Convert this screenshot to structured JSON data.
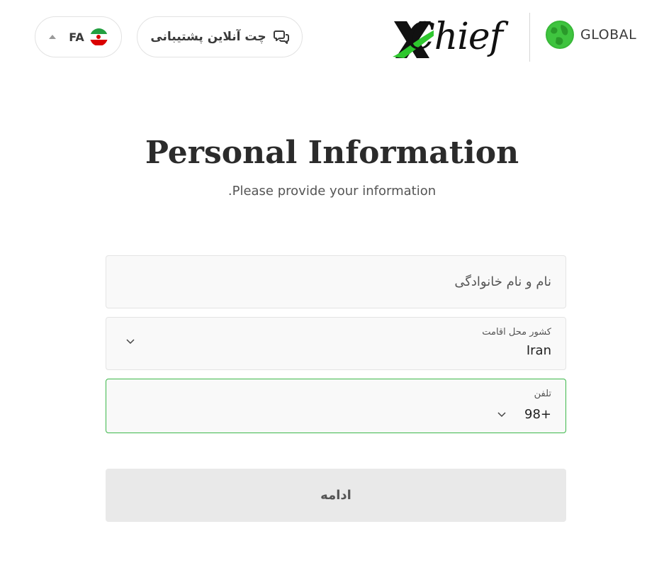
{
  "header": {
    "language": {
      "code": "FA",
      "flag_icon": "iran-flag-icon"
    },
    "support_chat": {
      "label": "چت آنلاین پشتیبانی",
      "icon": "chat-bubbles-icon"
    },
    "brand": {
      "logo_text": "Chief",
      "logo_mark": "X"
    },
    "region": {
      "label": "GLOBAL",
      "icon": "globe-icon"
    }
  },
  "main": {
    "title": "Personal Information",
    "subtitle": "Please provide your information."
  },
  "form": {
    "name": {
      "placeholder": "نام و نام خانوادگی",
      "value": ""
    },
    "country": {
      "label": "کشور محل اقامت",
      "value": "Iran"
    },
    "phone": {
      "label": "تلفن",
      "code": "+98"
    },
    "submit_label": "ادامه"
  },
  "colors": {
    "accent_green": "#3cb84a",
    "button_bg": "#e9e9e9",
    "text_dark": "#2b2b2b"
  }
}
